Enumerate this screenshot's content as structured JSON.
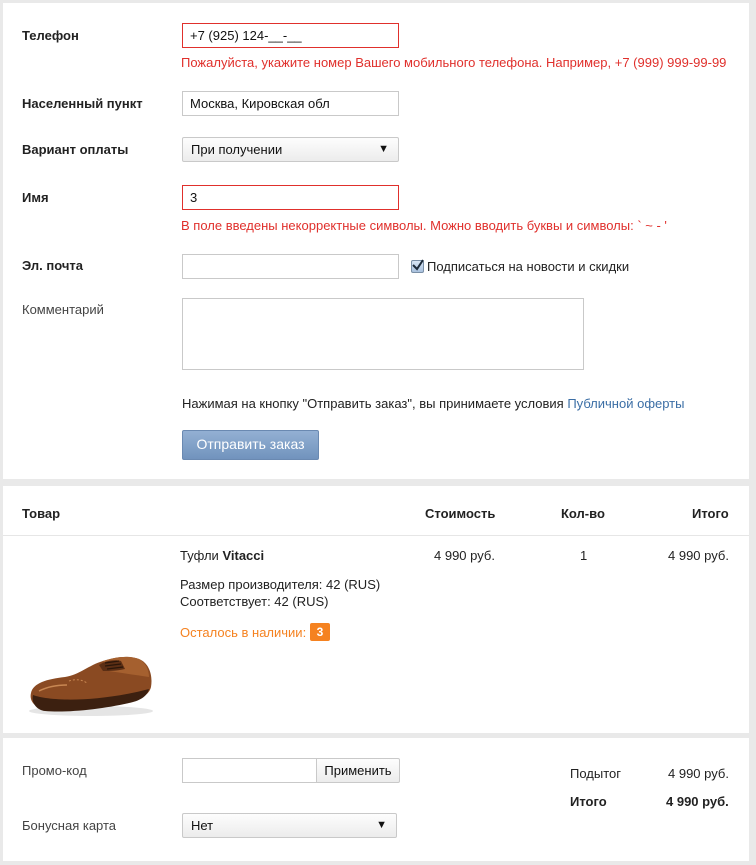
{
  "form": {
    "phone": {
      "label": "Телефон",
      "value": "+7 (925) 124-__-__",
      "error": "Пожалуйста, укажите номер Вашего мобильного телефона. Например, +7 (999) 999-99-99"
    },
    "city": {
      "label": "Населенный пункт",
      "value": "Москва, Кировская обл"
    },
    "payment": {
      "label": "Вариант оплаты",
      "value": "При получении"
    },
    "name": {
      "label": "Имя",
      "value": "3",
      "error": "В поле введены некорректные символы. Можно вводить буквы и символы: ` ~ - '"
    },
    "email": {
      "label": "Эл. почта",
      "value": "",
      "subscribe_label": "Подписаться на новости и скидки",
      "subscribe_checked": true
    },
    "comment": {
      "label": "Комментарий",
      "value": ""
    },
    "terms_text": "Нажимая на кнопку \"Отправить заказ\", вы принимаете условия ",
    "terms_link": "Публичной оферты",
    "submit_label": "Отправить заказ"
  },
  "cart": {
    "columns": {
      "product": "Товар",
      "price": "Стоимость",
      "qty": "Кол-во",
      "total": "Итого"
    },
    "items": [
      {
        "name_prefix": "Туфли ",
        "brand": "Vitacci",
        "size_label": "Размер производителя: 42 (RUS)",
        "fits_label": "Соответствует: 42 (RUS)",
        "stock_label": "Осталось в наличии:",
        "stock_count": "3",
        "price": "4 990 руб.",
        "qty": "1",
        "total": "4 990 руб.",
        "image_icon": "brown-oxford-shoe"
      }
    ]
  },
  "promo": {
    "label": "Промо-код",
    "value": "",
    "apply_label": "Применить",
    "bonus_label": "Бонусная карта",
    "bonus_value": "Нет",
    "subtotal_label": "Подытог",
    "subtotal_value": "4 990 руб.",
    "total_label": "Итого",
    "total_value": "4 990 руб."
  },
  "colors": {
    "error": "#e0302c",
    "link": "#3b6ea5",
    "submit": "#7f9fc7",
    "stock_badge": "#f58220"
  }
}
